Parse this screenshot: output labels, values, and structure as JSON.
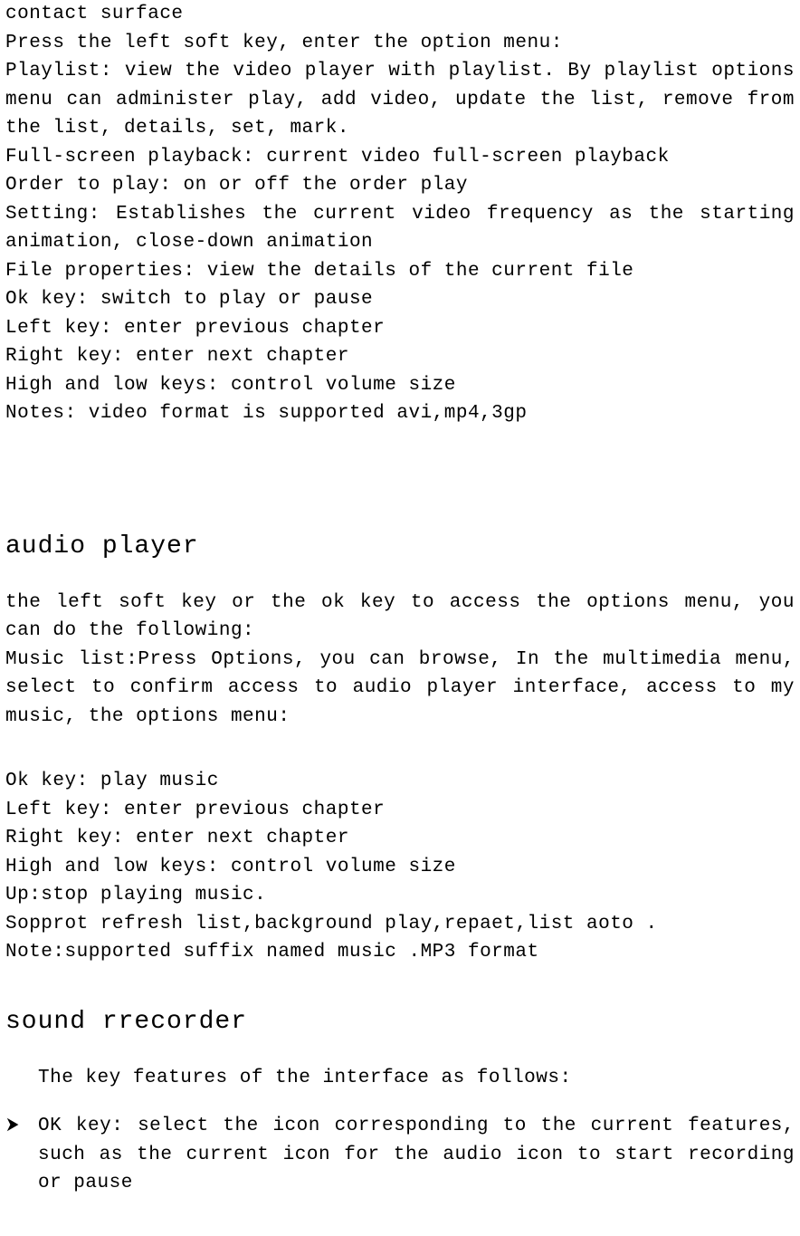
{
  "lines": {
    "l1": "contact surface",
    "l2": "Press the left soft key, enter the option menu:",
    "l3": "Playlist: view the video player with playlist. By playlist options menu can administer play, add video, update the list, remove from the list, details, set, mark.",
    "l4": "Full-screen playback: current video full-screen playback",
    "l5": "Order to play: on or off the order play",
    "l6": "Setting: Establishes the current video frequency as the starting animation, close-down animation",
    "l7": "File properties: view the details of the current file",
    "l8": "Ok key: switch to play or pause",
    "l9": "Left key: enter previous chapter",
    "l10": "Right key: enter next chapter",
    "l11": "High and low keys: control volume size",
    "l12": "Notes: video format is supported avi,mp4,3gp"
  },
  "heading1": "audio player",
  "audio": {
    "p1": "the left soft key or the ok key to access the options menu, you can do the following:",
    "p2": "Music list:Press Options, you can browse, In the multimedia menu, select to confirm access to audio player interface, access to my music, the options menu:",
    "k1": "Ok key: play music",
    "k2": "Left key: enter previous chapter",
    "k3": "Right key: enter next chapter",
    "k4": "High and low keys: control volume size",
    "k5": "Up:stop playing music.",
    "k6": "Sopprot refresh list,background play,repaet,list aoto .",
    "k7": "Note:supported suffix named music .MP3 format"
  },
  "heading2": "sound  rrecorder",
  "rec": {
    "intro": "The key features of the interface as follows:",
    "b1": "OK key: select the icon corresponding to the current features, such as the current icon for the audio icon to start recording or pause"
  }
}
